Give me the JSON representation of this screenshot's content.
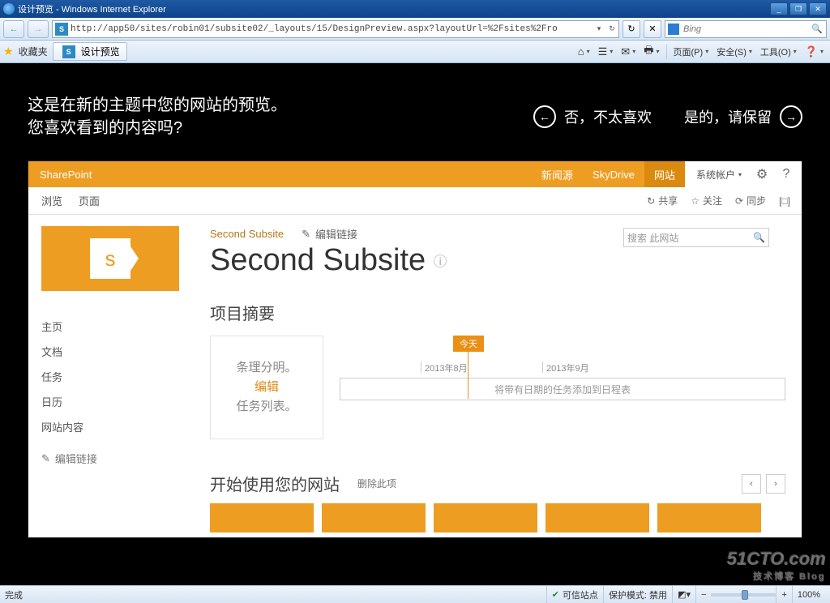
{
  "window": {
    "title": "设计预览 - Windows Internet Explorer",
    "min": "_",
    "restore": "❐",
    "close": "✕"
  },
  "nav": {
    "back": "←",
    "fwd": "→",
    "url": "http://app50/sites/robin01/subsite02/_layouts/15/DesignPreview.aspx?layoutUrl=%2Fsites%2Fro",
    "refresh": "↻",
    "stop": "✕",
    "search_placeholder": "Bing",
    "search_icon": "🔍"
  },
  "favbar": {
    "favorites": "收藏夹",
    "tab_title": "设计预览",
    "cmd_home": "⌂",
    "cmd_feeds": "☰",
    "cmd_mail": "✉",
    "cmd_print": "🖶",
    "cmd_page": "页面(P)",
    "cmd_safety": "安全(S)",
    "cmd_tools": "工具(O)",
    "cmd_help": "❓"
  },
  "banner": {
    "line1": "这是在新的主题中您的网站的预览。",
    "line2": "您喜欢看到的内容吗?",
    "no": "否，不太喜欢",
    "yes": "是的，请保留"
  },
  "suite": {
    "brand": "SharePoint",
    "newsfeed": "新闻源",
    "skydrive": "SkyDrive",
    "sites": "网站",
    "account": "系统帐户",
    "gear": "⚙",
    "help": "?"
  },
  "ribbon": {
    "browse": "浏览",
    "page": "页面",
    "share": "共享",
    "follow": "关注",
    "sync": "同步",
    "focus": "[□]",
    "share_icon": "�カ",
    "follow_icon": "☆",
    "sync_icon": "⟳"
  },
  "quicklaunch": {
    "items": [
      "主页",
      "文档",
      "任务",
      "日历",
      "网站内容"
    ],
    "edit": "编辑链接",
    "edit_icon": "✎"
  },
  "page": {
    "breadcrumb": "Second Subsite",
    "edit_links": "编辑链接",
    "edit_icon": "✎",
    "title": "Second Subsite",
    "search_placeholder": "搜索 此网站",
    "search_icon": "🔍"
  },
  "summary": {
    "heading": "项目摘要",
    "card_l1": "条理分明。",
    "card_edit": "编辑",
    "card_l3": "任务列表。",
    "today": "今天",
    "month1": "2013年8月",
    "month2": "2013年9月",
    "tl_hint": "将带有日期的任务添加到日程表"
  },
  "getstarted": {
    "heading": "开始使用您的网站",
    "remove": "删除此项",
    "prev": "‹",
    "next": "›"
  },
  "status": {
    "done": "完成",
    "trusted": "可信站点",
    "protected": "保护模式: 禁用",
    "zoom": "100%"
  },
  "watermark": {
    "main": "51CTO.com",
    "sub": "技术博客  Blog"
  }
}
